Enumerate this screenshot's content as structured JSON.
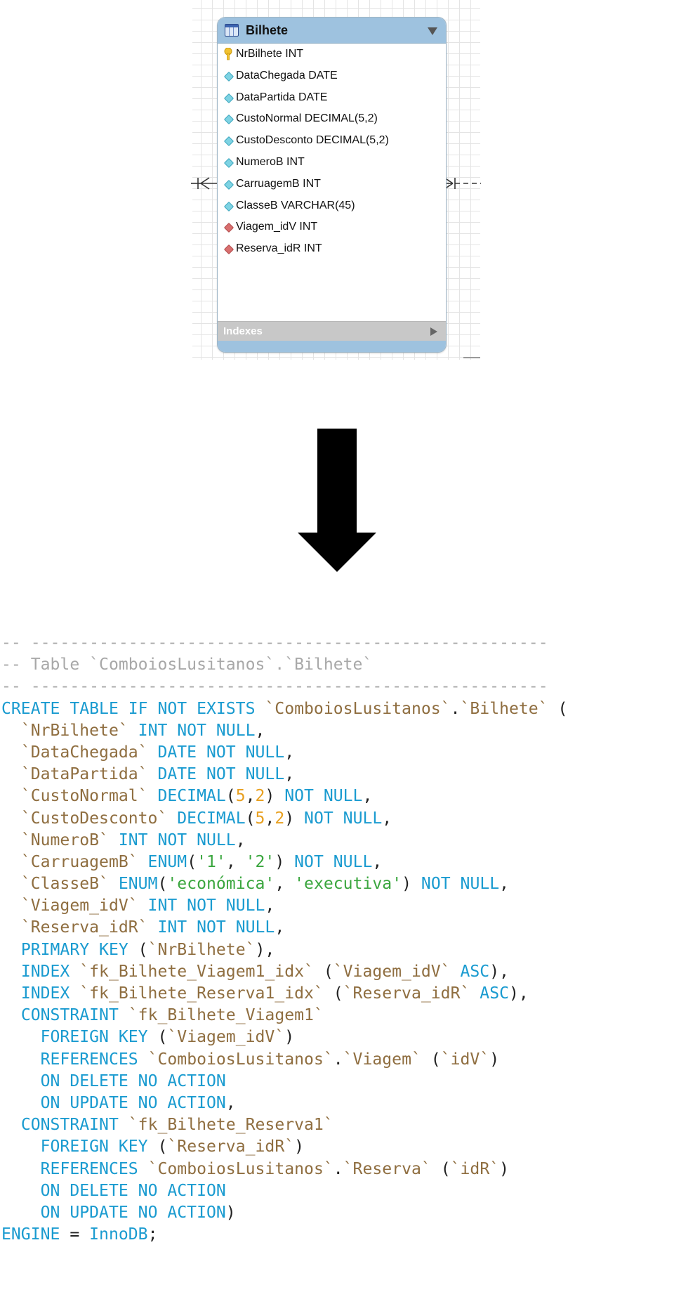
{
  "diagram": {
    "entity": {
      "title": "Bilhete",
      "columns": [
        {
          "label": "NrBilhete INT",
          "kind": "pk",
          "icon": "key-icon"
        },
        {
          "label": "DataChegada DATE",
          "kind": "attr",
          "icon": "diamond-attribute-icon"
        },
        {
          "label": "DataPartida DATE",
          "kind": "attr",
          "icon": "diamond-attribute-icon"
        },
        {
          "label": "CustoNormal DECIMAL(5,2)",
          "kind": "attr",
          "icon": "diamond-attribute-icon"
        },
        {
          "label": "CustoDesconto DECIMAL(5,2)",
          "kind": "attr",
          "icon": "diamond-attribute-icon"
        },
        {
          "label": "NumeroB INT",
          "kind": "attr",
          "icon": "diamond-attribute-icon"
        },
        {
          "label": "CarruagemB INT",
          "kind": "attr",
          "icon": "diamond-attribute-icon"
        },
        {
          "label": "ClasseB VARCHAR(45)",
          "kind": "attr",
          "icon": "diamond-attribute-icon"
        },
        {
          "label": "Viagem_idV INT",
          "kind": "fk",
          "icon": "diamond-foreign-key-icon"
        },
        {
          "label": "Reserva_idR INT",
          "kind": "fk",
          "icon": "diamond-foreign-key-icon"
        }
      ],
      "indexes_label": "Indexes"
    },
    "colors": {
      "header": "#9ec2df",
      "attribute_icon": "#7ed3e3",
      "foreign_key_icon": "#d96f6f",
      "primary_key_icon": "#f2c230",
      "indexes_bar": "#c8c8c8"
    }
  },
  "code": {
    "colors": {
      "comment": "#a8a8a8",
      "keyword": "#1a9bd0",
      "identifier": "#8f6e40",
      "number": "#e8a020",
      "string": "#3aa63e",
      "punctuation": "#222222"
    },
    "lines": [
      [
        [
          "comment",
          "-- -----------------------------------------------------"
        ]
      ],
      [
        [
          "comment",
          "-- Table `ComboiosLusitanos`.`Bilhete`"
        ]
      ],
      [
        [
          "comment",
          "-- -----------------------------------------------------"
        ]
      ],
      [
        [
          "kw",
          "CREATE TABLE IF NOT EXISTS "
        ],
        [
          "id",
          "`ComboiosLusitanos`"
        ],
        [
          "punct",
          "."
        ],
        [
          "id",
          "`Bilhete`"
        ],
        [
          "punct",
          " ("
        ]
      ],
      [
        [
          "punct",
          "  "
        ],
        [
          "id",
          "`NrBilhete`"
        ],
        [
          "kw",
          " INT NOT NULL"
        ],
        [
          "punct",
          ","
        ]
      ],
      [
        [
          "punct",
          "  "
        ],
        [
          "id",
          "`DataChegada`"
        ],
        [
          "kw",
          " DATE NOT NULL"
        ],
        [
          "punct",
          ","
        ]
      ],
      [
        [
          "punct",
          "  "
        ],
        [
          "id",
          "`DataPartida`"
        ],
        [
          "kw",
          " DATE NOT NULL"
        ],
        [
          "punct",
          ","
        ]
      ],
      [
        [
          "punct",
          "  "
        ],
        [
          "id",
          "`CustoNormal`"
        ],
        [
          "kw",
          " DECIMAL"
        ],
        [
          "punct",
          "("
        ],
        [
          "num",
          "5"
        ],
        [
          "punct",
          ","
        ],
        [
          "num",
          "2"
        ],
        [
          "punct",
          ") "
        ],
        [
          "kw",
          "NOT NULL"
        ],
        [
          "punct",
          ","
        ]
      ],
      [
        [
          "punct",
          "  "
        ],
        [
          "id",
          "`CustoDesconto`"
        ],
        [
          "kw",
          " DECIMAL"
        ],
        [
          "punct",
          "("
        ],
        [
          "num",
          "5"
        ],
        [
          "punct",
          ","
        ],
        [
          "num",
          "2"
        ],
        [
          "punct",
          ") "
        ],
        [
          "kw",
          "NOT NULL"
        ],
        [
          "punct",
          ","
        ]
      ],
      [
        [
          "punct",
          "  "
        ],
        [
          "id",
          "`NumeroB`"
        ],
        [
          "kw",
          " INT NOT NULL"
        ],
        [
          "punct",
          ","
        ]
      ],
      [
        [
          "punct",
          "  "
        ],
        [
          "id",
          "`CarruagemB`"
        ],
        [
          "kw",
          " ENUM"
        ],
        [
          "punct",
          "("
        ],
        [
          "str",
          "'1'"
        ],
        [
          "punct",
          ", "
        ],
        [
          "str",
          "'2'"
        ],
        [
          "punct",
          ") "
        ],
        [
          "kw",
          "NOT NULL"
        ],
        [
          "punct",
          ","
        ]
      ],
      [
        [
          "punct",
          "  "
        ],
        [
          "id",
          "`ClasseB`"
        ],
        [
          "kw",
          " ENUM"
        ],
        [
          "punct",
          "("
        ],
        [
          "str",
          "'económica'"
        ],
        [
          "punct",
          ", "
        ],
        [
          "str",
          "'executiva'"
        ],
        [
          "punct",
          ") "
        ],
        [
          "kw",
          "NOT NULL"
        ],
        [
          "punct",
          ","
        ]
      ],
      [
        [
          "punct",
          "  "
        ],
        [
          "id",
          "`Viagem_idV`"
        ],
        [
          "kw",
          " INT NOT NULL"
        ],
        [
          "punct",
          ","
        ]
      ],
      [
        [
          "punct",
          "  "
        ],
        [
          "id",
          "`Reserva_idR`"
        ],
        [
          "kw",
          " INT NOT NULL"
        ],
        [
          "punct",
          ","
        ]
      ],
      [
        [
          "punct",
          "  "
        ],
        [
          "kw",
          "PRIMARY KEY"
        ],
        [
          "punct",
          " ("
        ],
        [
          "id",
          "`NrBilhete`"
        ],
        [
          "punct",
          "),"
        ]
      ],
      [
        [
          "punct",
          "  "
        ],
        [
          "kw",
          "INDEX "
        ],
        [
          "id",
          "`fk_Bilhete_Viagem1_idx`"
        ],
        [
          "punct",
          " ("
        ],
        [
          "id",
          "`Viagem_idV`"
        ],
        [
          "kw",
          " ASC"
        ],
        [
          "punct",
          "),"
        ]
      ],
      [
        [
          "punct",
          "  "
        ],
        [
          "kw",
          "INDEX "
        ],
        [
          "id",
          "`fk_Bilhete_Reserva1_idx`"
        ],
        [
          "punct",
          " ("
        ],
        [
          "id",
          "`Reserva_idR`"
        ],
        [
          "kw",
          " ASC"
        ],
        [
          "punct",
          "),"
        ]
      ],
      [
        [
          "punct",
          "  "
        ],
        [
          "kw",
          "CONSTRAINT "
        ],
        [
          "id",
          "`fk_Bilhete_Viagem1`"
        ]
      ],
      [
        [
          "punct",
          "    "
        ],
        [
          "kw",
          "FOREIGN KEY"
        ],
        [
          "punct",
          " ("
        ],
        [
          "id",
          "`Viagem_idV`"
        ],
        [
          "punct",
          ")"
        ]
      ],
      [
        [
          "punct",
          "    "
        ],
        [
          "kw",
          "REFERENCES "
        ],
        [
          "id",
          "`ComboiosLusitanos`"
        ],
        [
          "punct",
          "."
        ],
        [
          "id",
          "`Viagem`"
        ],
        [
          "punct",
          " ("
        ],
        [
          "id",
          "`idV`"
        ],
        [
          "punct",
          ")"
        ]
      ],
      [
        [
          "punct",
          "    "
        ],
        [
          "kw",
          "ON DELETE NO ACTION"
        ]
      ],
      [
        [
          "punct",
          "    "
        ],
        [
          "kw",
          "ON UPDATE NO ACTION"
        ],
        [
          "punct",
          ","
        ]
      ],
      [
        [
          "punct",
          "  "
        ],
        [
          "kw",
          "CONSTRAINT "
        ],
        [
          "id",
          "`fk_Bilhete_Reserva1`"
        ]
      ],
      [
        [
          "punct",
          "    "
        ],
        [
          "kw",
          "FOREIGN KEY"
        ],
        [
          "punct",
          " ("
        ],
        [
          "id",
          "`Reserva_idR`"
        ],
        [
          "punct",
          ")"
        ]
      ],
      [
        [
          "punct",
          "    "
        ],
        [
          "kw",
          "REFERENCES "
        ],
        [
          "id",
          "`ComboiosLusitanos`"
        ],
        [
          "punct",
          "."
        ],
        [
          "id",
          "`Reserva`"
        ],
        [
          "punct",
          " ("
        ],
        [
          "id",
          "`idR`"
        ],
        [
          "punct",
          ")"
        ]
      ],
      [
        [
          "punct",
          "    "
        ],
        [
          "kw",
          "ON DELETE NO ACTION"
        ]
      ],
      [
        [
          "punct",
          "    "
        ],
        [
          "kw",
          "ON UPDATE NO ACTION"
        ],
        [
          "punct",
          ")"
        ]
      ],
      [
        [
          "kw",
          "ENGINE"
        ],
        [
          "punct",
          " = "
        ],
        [
          "kw",
          "InnoDB"
        ],
        [
          "punct",
          ";"
        ]
      ]
    ]
  }
}
